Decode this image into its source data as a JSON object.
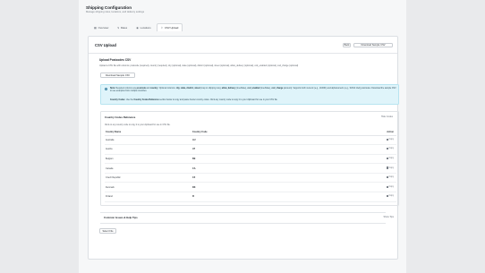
{
  "header": {
    "title": "Shipping Configuration",
    "subtitle": "Manage shipping rules, locations, and delivery settings"
  },
  "tabs": [
    {
      "label": "Overview",
      "icon": "grid-icon"
    },
    {
      "label": "Rates",
      "icon": "dollar-icon"
    },
    {
      "label": "Locations",
      "icon": "pin-icon"
    },
    {
      "label": "CSV Upload",
      "icon": "upload-icon",
      "active": true
    }
  ],
  "csv_card": {
    "title": "CSV Upload",
    "back_label": "Back",
    "download_sample_label": "Download Sample CSV"
  },
  "upload_section": {
    "title": "Upload Postcodes CSV",
    "description": "Upload a CSV file with columns: postcode (required), country (required), city (optional), state (optional), district (optional), street (optional), allow_delivery (optional), cod_enabled (optional), cod_charge (optional)",
    "download_sample_label": "Download Sample CSV"
  },
  "info": {
    "note_label": "Note:",
    "note_text_1": "Required columns are",
    "note_req": "postcode",
    "note_text_2": "and",
    "note_req2": "country",
    "note_text_3": ". Optional columns:",
    "note_opt": "city, state, district, street",
    "note_text_4": "(map to shipping rule),",
    "note_opt2": "allow_delivery",
    "note_text_5": "(true/false),",
    "note_opt3": "cod_enabled",
    "note_text_6": "(true/false),",
    "note_opt4": "cod_charge",
    "note_text_7": "(amount). Supports both numeric (e.g., 110001) and alphanumeric (e.g., SW1A 1AA) postcodes. Download the sample CSV to see examples from multiple countries.",
    "codes_label": "Country Codes:",
    "codes_text_1": "Use the",
    "codes_ref": "Country Codes Reference",
    "codes_text_2": "section below to copy and paste 2-letter country codes. Click any country code to copy it to your clipboard for use in your CSV file."
  },
  "reference": {
    "title": "Country Codes Reference",
    "toggle_label": "Hide Codes",
    "description": "Click on any country code to copy it to your clipboard for use in CSV file.",
    "columns": [
      "Country Name",
      "Country Code",
      "Action"
    ],
    "rows": [
      {
        "name": "Australia",
        "code": "AU",
        "action": "Copy"
      },
      {
        "name": "Austria",
        "code": "AT",
        "action": "Copy"
      },
      {
        "name": "Belgium",
        "code": "BE",
        "action": "Copy"
      },
      {
        "name": "Canada",
        "code": "CA",
        "action": "Copy"
      },
      {
        "name": "Czech Republic",
        "code": "CZ",
        "action": "Copy"
      },
      {
        "name": "Denmark",
        "code": "DK",
        "action": "Copy"
      },
      {
        "name": "Finland",
        "code": "FI",
        "action": "Copy"
      }
    ]
  },
  "help": {
    "title": "Common Issues & Help Tips",
    "toggle_label": "Show Tips"
  },
  "select_file_label": "Select File",
  "colors": {
    "info_bg": "#dff4fa",
    "info_border": "#b7e4f0",
    "card_bg": "#ffffff",
    "page_bg": "#e9eaec"
  }
}
